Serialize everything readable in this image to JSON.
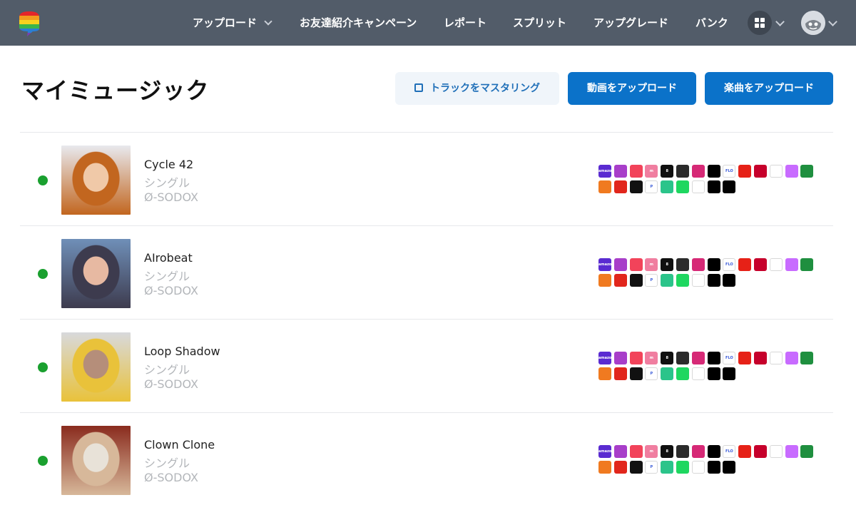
{
  "nav": {
    "items": [
      "アップロード",
      "お友達紹介キャンペーン",
      "レポート",
      "スプリット",
      "アップグレード",
      "バンク"
    ],
    "logo_colors": [
      "#e5252a",
      "#f39a1e",
      "#f7d21e",
      "#3bb54a",
      "#2a7fd4",
      "#7a3fb5"
    ]
  },
  "header": {
    "title": "マイミュージック",
    "master_label": "トラックをマスタリング",
    "video_label": "動画をアップロード",
    "song_label": "楽曲をアップロード"
  },
  "colors": {
    "nav_bg": "#525c69",
    "primary": "#0b72c9",
    "status_live": "#1aa02f"
  },
  "stores": [
    {
      "name": "amazon-music",
      "label": "amazon music",
      "color": "#5a2bd1"
    },
    {
      "name": "anghami",
      "label": "",
      "color": "#a83ec9"
    },
    {
      "name": "apple-music",
      "label": "",
      "color": "#f2435a"
    },
    {
      "name": "audiomack",
      "label": "m",
      "color": "#f07ea0"
    },
    {
      "name": "beatport",
      "label": "8",
      "color": "#101010"
    },
    {
      "name": "deezer",
      "label": "",
      "color": "#2b2b2b"
    },
    {
      "name": "instagram",
      "label": "",
      "color": "#d62976"
    },
    {
      "name": "joox",
      "label": "",
      "color": "#000000"
    },
    {
      "name": "flo",
      "label": "FLO",
      "color": "#ffffff"
    },
    {
      "name": "youtube-music",
      "label": "",
      "color": "#e62117"
    },
    {
      "name": "iheartradio",
      "label": "",
      "color": "#c6002b"
    },
    {
      "name": "kkbox",
      "label": "",
      "color": "#ffffff"
    },
    {
      "name": "itunes",
      "label": "",
      "color": "#c86bff"
    },
    {
      "name": "napster",
      "label": "",
      "color": "#1f8f3f"
    },
    {
      "name": "boomplay",
      "label": "",
      "color": "#f07a20"
    },
    {
      "name": "netease",
      "label": "",
      "color": "#e1261c"
    },
    {
      "name": "qobuz",
      "label": "",
      "color": "#111111"
    },
    {
      "name": "pandora",
      "label": "P",
      "color": "#ffffff"
    },
    {
      "name": "saavn",
      "label": "",
      "color": "#2bc48a"
    },
    {
      "name": "spotify",
      "label": "",
      "color": "#1ed760"
    },
    {
      "name": "tidal-alt",
      "label": "",
      "color": "#ffffff"
    },
    {
      "name": "tidal",
      "label": "",
      "color": "#000000"
    },
    {
      "name": "tiktok",
      "label": "",
      "color": "#000000"
    }
  ],
  "tracks": [
    {
      "title": "Cycle 42",
      "type": "シングル",
      "artist": "Ø-SODOX",
      "cover": [
        "#e8e9ee",
        "#c2661f",
        "#f0c9a8"
      ]
    },
    {
      "title": "AIrobeat",
      "type": "シングル",
      "artist": "Ø-SODOX",
      "cover": [
        "#6f8fb8",
        "#3d3b4e",
        "#e7b9a2"
      ]
    },
    {
      "title": "Loop Shadow",
      "type": "シングル",
      "artist": "Ø-SODOX",
      "cover": [
        "#d8d9dc",
        "#e9c23a",
        "#b58e7a"
      ]
    },
    {
      "title": "Clown Clone",
      "type": "シングル",
      "artist": "Ø-SODOX",
      "cover": [
        "#8a2b1e",
        "#d7b89a",
        "#e8e2d8"
      ]
    }
  ]
}
